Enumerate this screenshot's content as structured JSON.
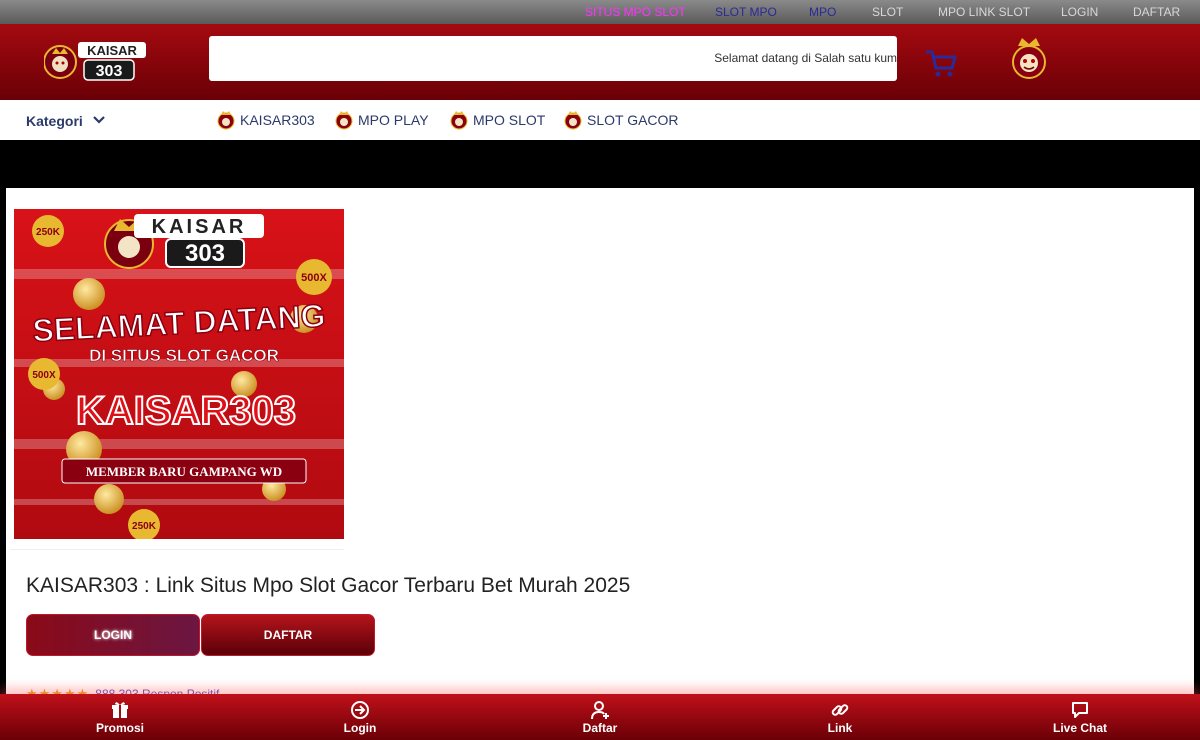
{
  "topnav": [
    {
      "label": "SITUS MPO SLOT",
      "color": "#ff33ff"
    },
    {
      "label": "SLOT MPO",
      "color": "#2a2a9a"
    },
    {
      "label": "MPO",
      "color": "#2a2a9a"
    },
    {
      "label": "SLOT",
      "color": "#d8d8d8"
    },
    {
      "label": "MPO LINK SLOT",
      "color": "#d8d8d8"
    },
    {
      "label": "LOGIN",
      "color": "#d8d8d8"
    },
    {
      "label": "DAFTAR",
      "color": "#d8d8d8"
    }
  ],
  "logo": {
    "line1": "KAISAR",
    "line2": "303"
  },
  "search": {
    "marquee": "Selamat datang di Salah satu kum"
  },
  "category": {
    "label": "Kategori",
    "links": [
      "KAISAR303",
      "MPO PLAY",
      "MPO SLOT",
      "SLOT GACOR"
    ]
  },
  "banner": {
    "brand_line1": "KAISAR",
    "brand_line2": "303",
    "headline": "SELAMAT DATANG",
    "subheadline": "DI SITUS SLOT GACOR",
    "big_text": "KAISAR303",
    "ribbon": "MEMBER BARU GAMPANG WD",
    "badge_top_left": "250K",
    "badge_top_right": "500X",
    "badge_mid_left": "500X",
    "badge_bottom": "250K"
  },
  "main": {
    "title": "KAISAR303 : Link Situs Mpo Slot Gacor Terbaru Bet Murah 2025",
    "login_label": "LOGIN",
    "daftar_label": "DAFTAR",
    "stars": "★★★★★",
    "rating_text": "888.303 Respon Positif"
  },
  "bottomnav": [
    "Promosi",
    "Login",
    "Daftar",
    "Link",
    "Live Chat"
  ],
  "colors": {
    "brand_red": "#a40a10",
    "dark_red": "#6a0006",
    "nav_text": "#2b3a6b"
  }
}
